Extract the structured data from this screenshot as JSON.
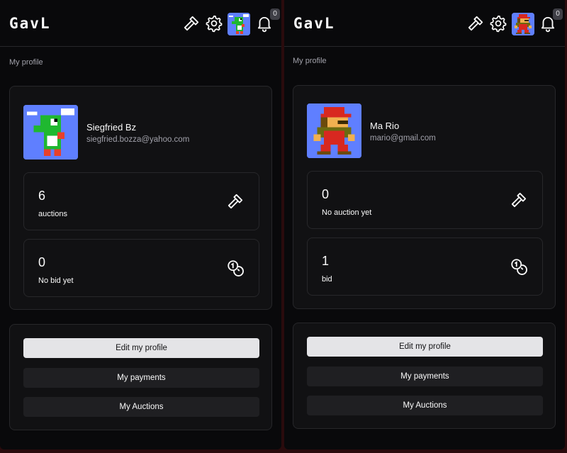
{
  "panels": [
    {
      "brand": "GavL",
      "notification_count": "0",
      "breadcrumb": "My profile",
      "user": {
        "name": "Siegfried Bz",
        "email": "siegfried.bozza@yahoo.com",
        "avatar": "yoshi-pixel-avatar"
      },
      "stats": [
        {
          "value": "6",
          "label": "auctions",
          "icon": "gavel-icon"
        },
        {
          "value": "0",
          "label": "No bid yet",
          "icon": "coins-icon"
        }
      ],
      "actions": [
        {
          "label": "Edit my profile"
        },
        {
          "label": "My payments"
        },
        {
          "label": "My Auctions"
        }
      ]
    },
    {
      "brand": "GavL",
      "notification_count": "0",
      "breadcrumb": "My profile",
      "user": {
        "name": "Ma Rio",
        "email": "mario@gmail.com",
        "avatar": "mario-pixel-avatar"
      },
      "stats": [
        {
          "value": "0",
          "label": "No auction yet",
          "icon": "gavel-icon"
        },
        {
          "value": "1",
          "label": "bid",
          "icon": "coins-icon"
        }
      ],
      "actions": [
        {
          "label": "Edit my profile"
        },
        {
          "label": "My payments"
        },
        {
          "label": "My Auctions"
        }
      ]
    }
  ],
  "colors": {
    "page_background": "#2a0b0d",
    "panel_background": "#09090b",
    "card_background": "#111113",
    "border": "#27272a",
    "primary_button": "#e4e4e7",
    "secondary_button": "#1f1f22",
    "avatar_background": "#5f7fff"
  }
}
